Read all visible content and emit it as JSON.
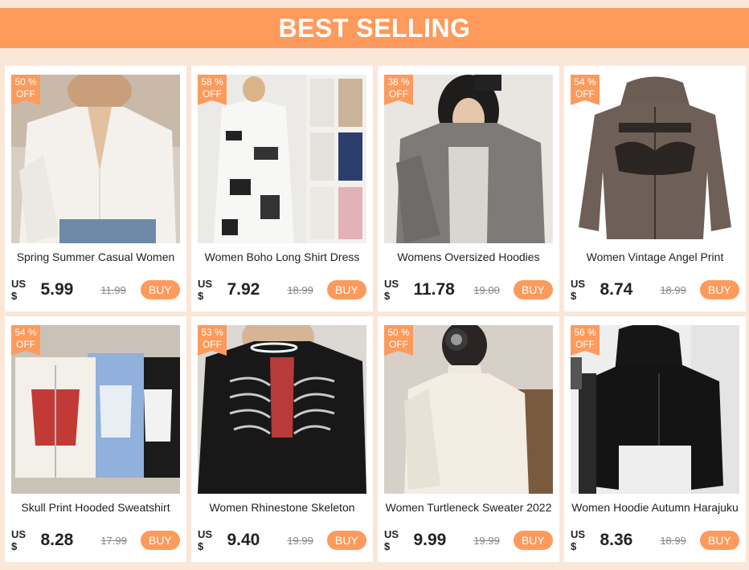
{
  "header": {
    "title": "BEST SELLING"
  },
  "currency_label": "US $",
  "buy_label": "BUY",
  "products": [
    {
      "title": "Spring Summer Casual  Women",
      "discount": "50",
      "percent": "%",
      "off": "OFF",
      "price": "5.99",
      "old_price": "11.99"
    },
    {
      "title": "Women Boho Long Shirt Dress",
      "discount": "58",
      "percent": "%",
      "off": "OFF",
      "price": "7.92",
      "old_price": "18.99"
    },
    {
      "title": "Womens Oversized Hoodies",
      "discount": "38",
      "percent": "%",
      "off": "OFF",
      "price": "11.78",
      "old_price": "19.00"
    },
    {
      "title": "Women Vintage Angel Print",
      "discount": "54",
      "percent": "%",
      "off": "OFF",
      "price": "8.74",
      "old_price": "18.99"
    },
    {
      "title": "Skull Print Hooded Sweatshirt",
      "discount": "54",
      "percent": "%",
      "off": "OFF",
      "price": "8.28",
      "old_price": "17.99"
    },
    {
      "title": "Women Rhinestone Skeleton",
      "discount": "53",
      "percent": "%",
      "off": "OFF",
      "price": "9.40",
      "old_price": "19.99"
    },
    {
      "title": "Women Turtleneck Sweater 2022",
      "discount": "50",
      "percent": "%",
      "off": "OFF",
      "price": "9.99",
      "old_price": "19.99"
    },
    {
      "title": "Women Hoodie Autumn Harajuku",
      "discount": "56",
      "percent": "%",
      "off": "OFF",
      "price": "8.36",
      "old_price": "18.99"
    }
  ],
  "colors": {
    "accent": "#fd9a5c",
    "background": "#fbe7d8"
  }
}
